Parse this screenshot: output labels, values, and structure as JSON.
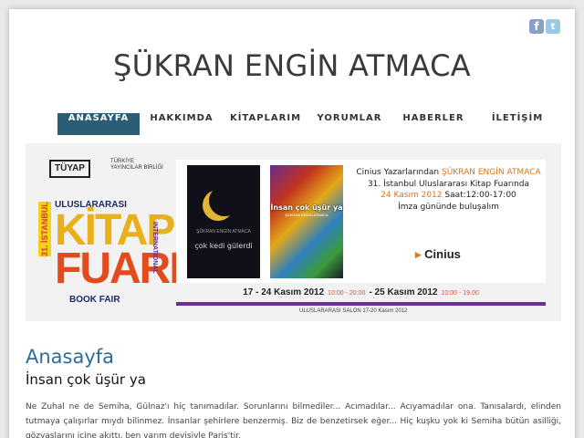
{
  "social": {
    "facebook_icon": "facebook-icon",
    "twitter_icon": "twitter-icon"
  },
  "site": {
    "title": "ŞÜKRAN ENGİN ATMACA"
  },
  "nav": {
    "items": [
      {
        "label": "ANASAYFA",
        "active": true
      },
      {
        "label": "HAKKIMDA",
        "active": false
      },
      {
        "label": "KİTAPLARIM",
        "active": false
      },
      {
        "label": "YORUMLAR",
        "active": false
      },
      {
        "label": "HABERLER",
        "active": false
      },
      {
        "label": "İLETİŞİM",
        "active": false
      }
    ]
  },
  "banner": {
    "logo1": "TÜYAP",
    "logo2": "TÜRKİYE YAYINCILAR BİRLİĞİ",
    "fair_top": "ULUSLARARASI",
    "fair_no": "31. İSTANBUL",
    "fair_word1": "KİTAP",
    "fair_word2": "FUARI",
    "fair_intl": "INTERNATIONAL",
    "fair_bottom": "BOOK FAIR",
    "book1_title": "çok kedi gülerdi",
    "book1_author": "ŞÜKRAN ENGİN ATMACA",
    "book2_title": "İnsan çok üşür ya",
    "book2_author": "ŞÜKRAN ENGİN ATMACA",
    "line1_prefix": "Cinius Yazarlarından ",
    "line1_name": "ŞÜKRAN ENGİN ATMACA",
    "line2": "31. İstanbul Uluslararası Kitap Fuarında",
    "line3_date": "24 Kasım 2012",
    "line3_time": " Saat:12:00-17:00",
    "line4": "İmza gününde buluşalım",
    "publisher": "Cinius",
    "dates_a": "17 - 24 Kasım 2012",
    "times_a": "10:00 - 20:00",
    "dates_b": "- 25 Kasım 2012",
    "times_b": "10:00 - 19.00",
    "salon": "ULUSLARARASI SALON 17-20 Kasım 2012"
  },
  "content": {
    "heading": "Anasayfa",
    "post_title": "İnsan çok üşür ya",
    "body": "Ne Zuhal ne de Semiha, Gülnaz'ı hiç tanımadılar. Sorunlarını bilmediler... Acımadılar... Acıyamadılar ona. Tanısalardı, elinden tutmaya çalışırlar mıydı bilinmez. İnsanlar şehirlere benzermiş. Biz de benzetirsek eğer... Hiç kuşku yok ki Semiha bütün asilliği, gözyaşlarını içine akıttı, ben varım deyişiyle Paris'tir."
  }
}
